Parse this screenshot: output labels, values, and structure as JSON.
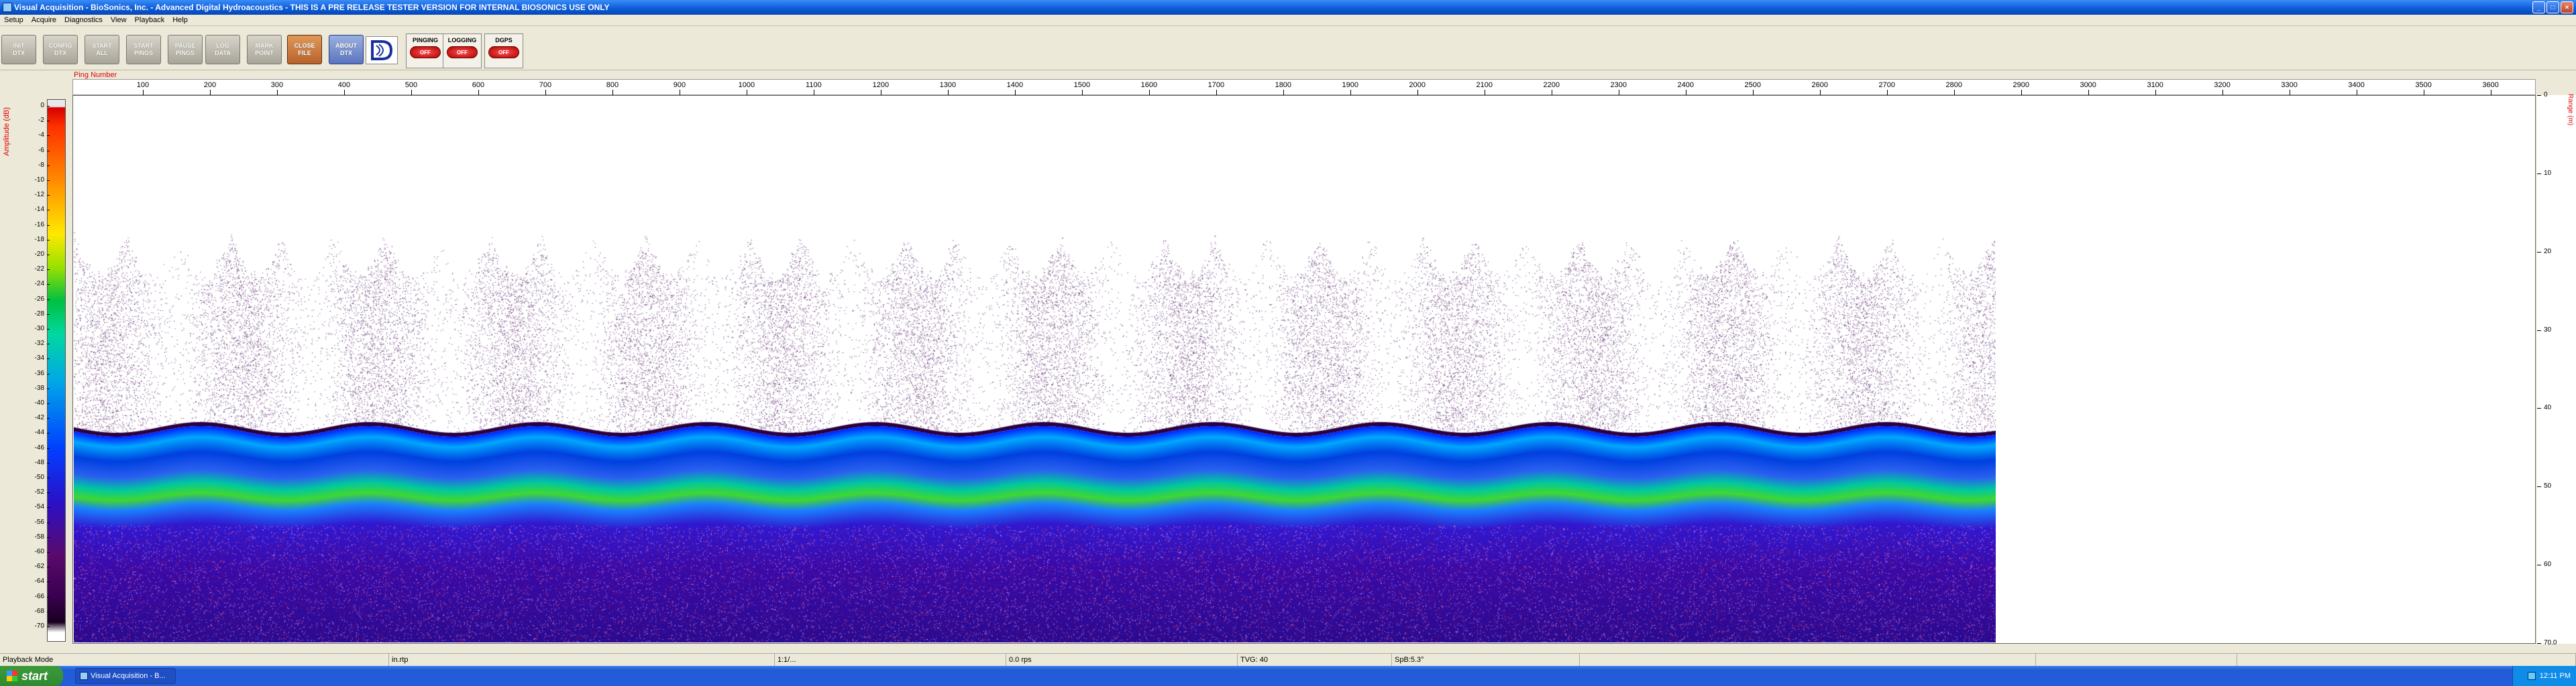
{
  "window": {
    "title": "Visual Acquisition  - BioSonics, Inc.  - Advanced Digital Hydroacoustics  - THIS IS A PRE RELEASE TESTER VERSION FOR INTERNAL BIOSONICS USE ONLY"
  },
  "menu": [
    "Setup",
    "Acquire",
    "Diagnostics",
    "View",
    "Playback",
    "Help"
  ],
  "toolbar": [
    {
      "label": "INIT\nDTX",
      "kind": "gray"
    },
    {
      "label": "CONFIG\nDTX",
      "kind": "gray"
    },
    {
      "label": "START\nALL",
      "kind": "gray"
    },
    {
      "label": "START\nPINGS",
      "kind": "gray"
    },
    {
      "label": "PAUSE\nPINGS",
      "kind": "gray"
    },
    {
      "label": "LOG\nDATA",
      "kind": "gray"
    },
    {
      "label": "MARK\nPOINT",
      "kind": "gray"
    },
    {
      "label": "CLOSE\nFILE",
      "kind": "close"
    },
    {
      "label": "ABOUT\nDTX",
      "kind": "about"
    }
  ],
  "indicators": [
    {
      "label": "PINGING",
      "state": "OFF"
    },
    {
      "label": "LOGGING",
      "state": "OFF"
    },
    {
      "label": "DGPS",
      "state": "OFF"
    }
  ],
  "plot": {
    "x_axis_title": "Ping Number",
    "x_ticks": [
      "100",
      "200",
      "300",
      "400",
      "500",
      "600",
      "700",
      "800",
      "900",
      "1000",
      "1100",
      "1200",
      "1300",
      "1400",
      "1500",
      "1600",
      "1700",
      "1800",
      "1900",
      "2000",
      "2100",
      "2200",
      "2300",
      "2400",
      "2500",
      "2600",
      "2700",
      "2800",
      "2900",
      "3000",
      "3100",
      "3200",
      "3300",
      "3400",
      "3500",
      "3600"
    ],
    "colorbar_title": "Amplitude (dB)",
    "colorbar_ticks": [
      "0",
      "-2",
      "-4",
      "-6",
      "-8",
      "-10",
      "-12",
      "-14",
      "-16",
      "-18",
      "-20",
      "-22",
      "-24",
      "-26",
      "-28",
      "-30",
      "-32",
      "-34",
      "-36",
      "-38",
      "-40",
      "-42",
      "-44",
      "-46",
      "-48",
      "-50",
      "-52",
      "-54",
      "-56",
      "-58",
      "-60",
      "-62",
      "-64",
      "-66",
      "-68",
      "-70"
    ],
    "range_axis_title": "Range (m)",
    "range_ticks": [
      "0",
      "10",
      "20",
      "30",
      "40",
      "50",
      "60",
      "70.0"
    ]
  },
  "status": [
    "Playback Mode",
    "in.rtp",
    "1:1/...",
    "0.0 rps",
    "TVG: 40",
    "SpB:5.3°",
    "",
    "",
    ""
  ],
  "taskbar": {
    "start": "start",
    "item": "Visual Acquisition  - B...",
    "time": "12:11 PM"
  }
}
